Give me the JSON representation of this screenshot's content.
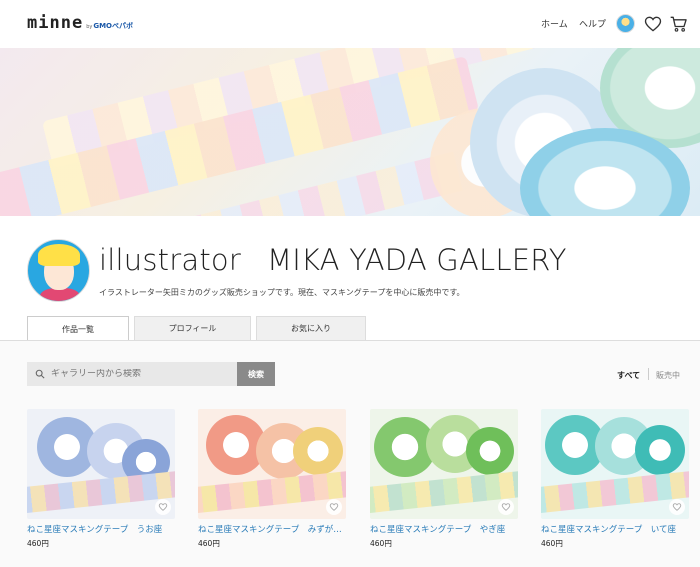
{
  "header": {
    "logo_main": "minne",
    "logo_by": "by",
    "logo_company": "GMOペパボ",
    "nav_home": "ホーム",
    "nav_help": "ヘルプ",
    "icons": [
      "avatar",
      "heart-icon",
      "cart-icon"
    ]
  },
  "profile": {
    "name_part1": "illustrator",
    "name_part2": "MIKA YADA GALLERY",
    "description": "イラストレーター矢田ミカのグッズ販売ショップです。現在、マスキングテープを中心に販売中です。"
  },
  "tabs": [
    {
      "label": "作品一覧",
      "active": true
    },
    {
      "label": "プロフィール",
      "active": false
    },
    {
      "label": "お気に入り",
      "active": false
    }
  ],
  "search": {
    "placeholder": "ギャラリー内から検索",
    "button_label": "検索"
  },
  "filters": {
    "all_label": "すべて",
    "on_sale_label": "販売中",
    "selected": "すべて"
  },
  "products": [
    {
      "title": "ねこ星座マスキングテープ　うお座",
      "price": "460円",
      "color": "#6f8fc9"
    },
    {
      "title": "ねこ星座マスキングテープ　みずが…",
      "price": "460円",
      "color": "#e8735e"
    },
    {
      "title": "ねこ星座マスキングテープ　やぎ座",
      "price": "460円",
      "color": "#6fbf5a"
    },
    {
      "title": "ねこ星座マスキングテープ　いて座",
      "price": "460円",
      "color": "#3fbcb6"
    }
  ]
}
